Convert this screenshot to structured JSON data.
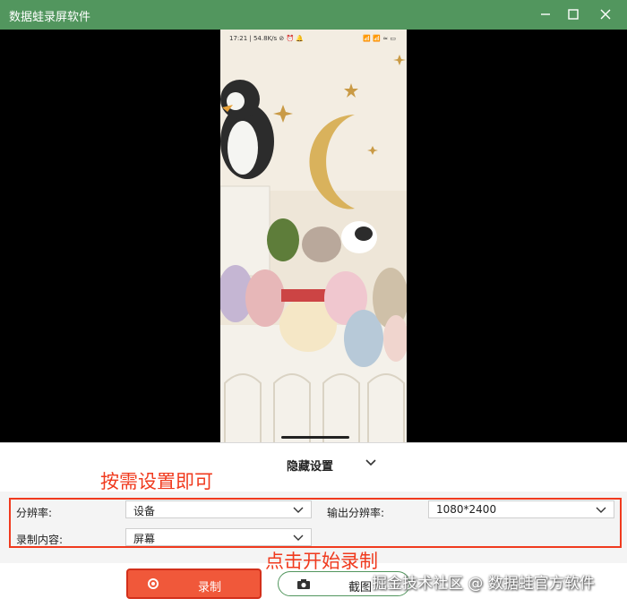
{
  "titlebar": {
    "title": "数据蛙录屏软件"
  },
  "phone": {
    "status_left": "17:21 | 54.8K/s ⊘ ⏰ 🔔",
    "status_right": "📶 📶 ≈ ▭"
  },
  "settings_panel": {
    "hide_label": "隐藏设置",
    "resolution_label": "分辨率:",
    "resolution_value": "设备",
    "output_resolution_label": "输出分辨率:",
    "output_resolution_value": "1080*2400",
    "record_content_label": "录制内容:",
    "record_content_value": "屏幕"
  },
  "annotations": {
    "settings_hint": "按需设置即可",
    "record_hint": "点击开始录制"
  },
  "buttons": {
    "record_label": "录制",
    "screenshot_label": "截图"
  },
  "watermark": "掘金技术社区 @ 数据蛙官方软件",
  "colors": {
    "titlebar": "#52965e",
    "accent_red": "#f03a1e",
    "record_button": "#f0583a"
  }
}
